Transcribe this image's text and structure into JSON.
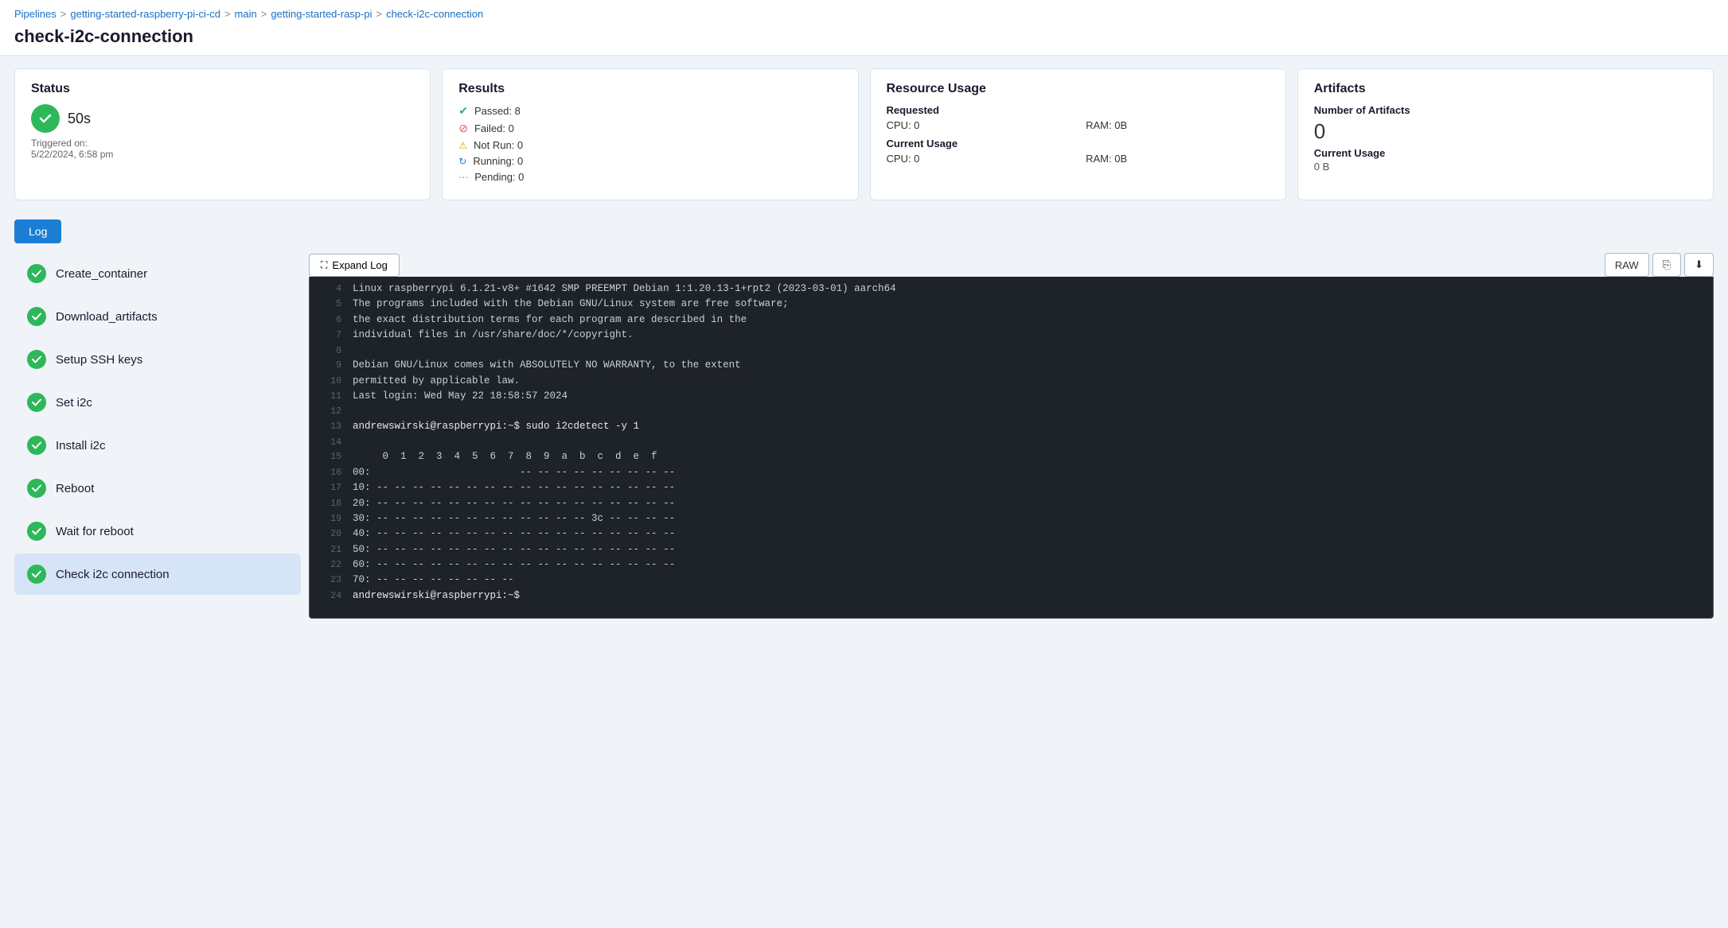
{
  "breadcrumb": {
    "items": [
      {
        "label": "Pipelines",
        "link": true
      },
      {
        "label": "getting-started-raspberry-pi-ci-cd",
        "link": true
      },
      {
        "label": "main",
        "link": true
      },
      {
        "label": "getting-started-rasp-pi",
        "link": true
      },
      {
        "label": "check-i2c-connection",
        "link": true
      }
    ],
    "separators": [
      ">",
      ">",
      ">",
      ">"
    ]
  },
  "page_title": "check-i2c-connection",
  "status_card": {
    "title": "Status",
    "time": "50s",
    "triggered_label": "Triggered on:",
    "triggered_date": "5/22/2024, 6:58 pm"
  },
  "results_card": {
    "title": "Results",
    "items": [
      {
        "label": "Passed: 8",
        "type": "passed"
      },
      {
        "label": "Failed: 0",
        "type": "failed"
      },
      {
        "label": "Not Run: 0",
        "type": "notrun"
      },
      {
        "label": "Running: 0",
        "type": "running"
      },
      {
        "label": "Pending: 0",
        "type": "pending"
      }
    ]
  },
  "resource_card": {
    "title": "Resource Usage",
    "requested_label": "Requested",
    "requested_cpu": "CPU: 0",
    "requested_ram": "RAM: 0B",
    "current_label": "Current Usage",
    "current_cpu": "CPU: 0",
    "current_ram": "RAM: 0B"
  },
  "artifacts_card": {
    "title": "Artifacts",
    "number_label": "Number of Artifacts",
    "number": "0",
    "current_label": "Current Usage",
    "current_val": "0 B"
  },
  "log_tab": {
    "label": "Log"
  },
  "steps": [
    {
      "label": "Create_container",
      "status": "passed"
    },
    {
      "label": "Download_artifacts",
      "status": "passed"
    },
    {
      "label": "Setup SSH keys",
      "status": "passed"
    },
    {
      "label": "Set i2c",
      "status": "passed"
    },
    {
      "label": "Install i2c",
      "status": "passed"
    },
    {
      "label": "Reboot",
      "status": "passed"
    },
    {
      "label": "Wait for reboot",
      "status": "passed"
    },
    {
      "label": "Check i2c connection",
      "status": "passed",
      "active": true
    }
  ],
  "log_toolbar": {
    "expand_label": "Expand Log",
    "raw_label": "RAW",
    "copy_label": "⎘",
    "download_label": "⬇"
  },
  "terminal_lines": [
    {
      "num": 4,
      "text": "Linux raspberrypi 6.1.21-v8+ #1642 SMP PREEMPT Debian 1:1.20.13-1+rpt2 (2023-03-01) aarch64"
    },
    {
      "num": 5,
      "text": "The programs included with the Debian GNU/Linux system are free software;"
    },
    {
      "num": 6,
      "text": "the exact distribution terms for each program are described in the"
    },
    {
      "num": 7,
      "text": "individual files in /usr/share/doc/*/copyright."
    },
    {
      "num": 8,
      "text": ""
    },
    {
      "num": 9,
      "text": "Debian GNU/Linux comes with ABSOLUTELY NO WARRANTY, to the extent"
    },
    {
      "num": 10,
      "text": "permitted by applicable law."
    },
    {
      "num": 11,
      "text": "Last login: Wed May 22 18:58:57 2024"
    },
    {
      "num": 12,
      "text": ""
    },
    {
      "num": 13,
      "text": "andrewswirski@raspberrypi:~$ sudo i2cdetect -y 1",
      "type": "cmd"
    },
    {
      "num": 14,
      "text": ""
    },
    {
      "num": 15,
      "text": "     0  1  2  3  4  5  6  7  8  9  a  b  c  d  e  f"
    },
    {
      "num": 16,
      "text": "00:                         -- -- -- -- -- -- -- -- --"
    },
    {
      "num": 17,
      "text": "10: -- -- -- -- -- -- -- -- -- -- -- -- -- -- -- -- --"
    },
    {
      "num": 18,
      "text": "20: -- -- -- -- -- -- -- -- -- -- -- -- -- -- -- -- --"
    },
    {
      "num": 19,
      "text": "30: -- -- -- -- -- -- -- -- -- -- -- -- 3c -- -- -- --"
    },
    {
      "num": 20,
      "text": "40: -- -- -- -- -- -- -- -- -- -- -- -- -- -- -- -- --"
    },
    {
      "num": 21,
      "text": "50: -- -- -- -- -- -- -- -- -- -- -- -- -- -- -- -- --"
    },
    {
      "num": 22,
      "text": "60: -- -- -- -- -- -- -- -- -- -- -- -- -- -- -- -- --"
    },
    {
      "num": 23,
      "text": "70: -- -- -- -- -- -- -- --"
    },
    {
      "num": 24,
      "text": "andrewswirski@raspberrypi:~$",
      "type": "cmd"
    }
  ]
}
